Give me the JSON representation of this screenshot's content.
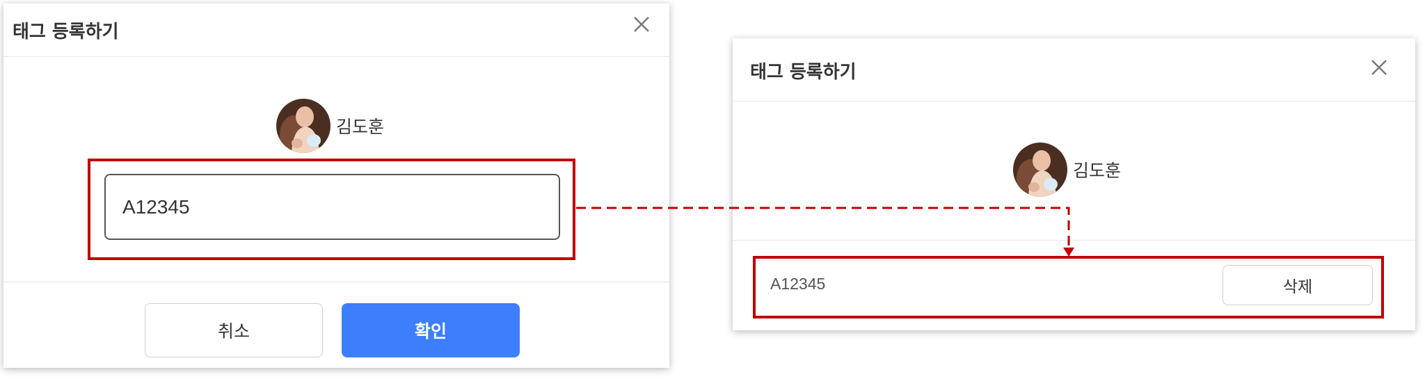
{
  "left_dialog": {
    "title": "태그 등록하기",
    "close_icon": "close-icon",
    "user": {
      "name": "김도훈",
      "avatar": "user-avatar-photo"
    },
    "tag_input": {
      "value": "A12345"
    },
    "cancel_label": "취소",
    "confirm_label": "확인"
  },
  "right_dialog": {
    "title": "태그 등록하기",
    "close_icon": "close-icon",
    "user": {
      "name": "김도훈",
      "avatar": "user-avatar-photo"
    },
    "tag": {
      "value": "A12345",
      "delete_label": "삭제"
    }
  },
  "colors": {
    "highlight": "#c00000",
    "confirm_button": "#3d7efd",
    "divider": "#e6e6e6"
  }
}
